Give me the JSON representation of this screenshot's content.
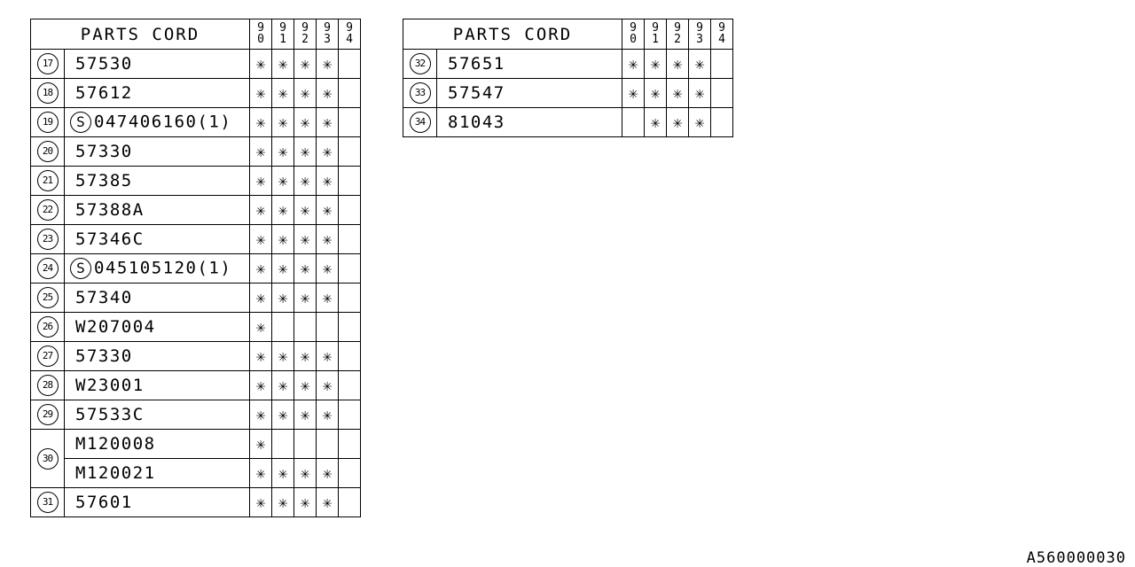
{
  "header": {
    "title": "PARTS CORD",
    "years": [
      [
        "9",
        "0"
      ],
      [
        "9",
        "1"
      ],
      [
        "9",
        "2"
      ],
      [
        "9",
        "3"
      ],
      [
        "9",
        "4"
      ]
    ]
  },
  "star_glyph": "✳",
  "left_table": {
    "rows": [
      {
        "ref": "17",
        "part": "57530",
        "std": false,
        "marks": [
          true,
          true,
          true,
          true,
          false
        ]
      },
      {
        "ref": "18",
        "part": "57612",
        "std": false,
        "marks": [
          true,
          true,
          true,
          true,
          false
        ]
      },
      {
        "ref": "19",
        "part": "047406160(1)",
        "std": true,
        "marks": [
          true,
          true,
          true,
          true,
          false
        ]
      },
      {
        "ref": "20",
        "part": "57330",
        "std": false,
        "marks": [
          true,
          true,
          true,
          true,
          false
        ]
      },
      {
        "ref": "21",
        "part": "57385",
        "std": false,
        "marks": [
          true,
          true,
          true,
          true,
          false
        ]
      },
      {
        "ref": "22",
        "part": "57388A",
        "std": false,
        "marks": [
          true,
          true,
          true,
          true,
          false
        ]
      },
      {
        "ref": "23",
        "part": "57346C",
        "std": false,
        "marks": [
          true,
          true,
          true,
          true,
          false
        ]
      },
      {
        "ref": "24",
        "part": "045105120(1)",
        "std": true,
        "marks": [
          true,
          true,
          true,
          true,
          false
        ]
      },
      {
        "ref": "25",
        "part": "57340",
        "std": false,
        "marks": [
          true,
          true,
          true,
          true,
          false
        ]
      },
      {
        "ref": "26",
        "part": "W207004",
        "std": false,
        "marks": [
          true,
          false,
          false,
          false,
          false
        ]
      },
      {
        "ref": "27",
        "part": "57330",
        "std": false,
        "marks": [
          true,
          true,
          true,
          true,
          false
        ]
      },
      {
        "ref": "28",
        "part": "W23001",
        "std": false,
        "marks": [
          true,
          true,
          true,
          true,
          false
        ]
      },
      {
        "ref": "29",
        "part": "57533C",
        "std": false,
        "marks": [
          true,
          true,
          true,
          true,
          false
        ]
      },
      {
        "ref": "30",
        "part": "M120008",
        "std": false,
        "marks": [
          true,
          false,
          false,
          false,
          false
        ],
        "span": 2
      },
      {
        "ref": "",
        "part": "M120021",
        "std": false,
        "marks": [
          true,
          true,
          true,
          true,
          false
        ],
        "continued": true
      },
      {
        "ref": "31",
        "part": "57601",
        "std": false,
        "marks": [
          true,
          true,
          true,
          true,
          false
        ]
      }
    ]
  },
  "right_table": {
    "rows": [
      {
        "ref": "32",
        "part": "57651",
        "std": false,
        "marks": [
          true,
          true,
          true,
          true,
          false
        ]
      },
      {
        "ref": "33",
        "part": "57547",
        "std": false,
        "marks": [
          true,
          true,
          true,
          true,
          false
        ]
      },
      {
        "ref": "34",
        "part": "81043",
        "std": false,
        "marks": [
          false,
          true,
          true,
          true,
          false
        ]
      }
    ]
  },
  "std_symbol": "S",
  "footer": {
    "drawing_code": "A560000030"
  }
}
